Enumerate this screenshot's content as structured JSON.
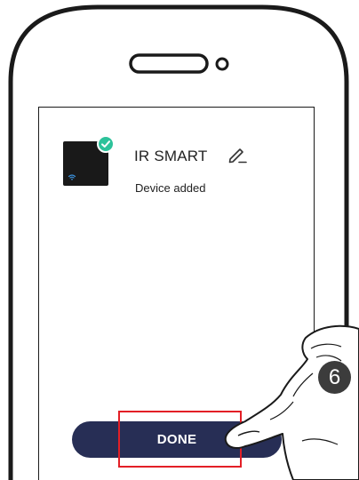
{
  "device": {
    "name": "IR SMART",
    "status": "Device added"
  },
  "icons": {
    "thumbnail": "device-thumbnail",
    "status_badge": "check-icon",
    "signal": "wifi-icon",
    "rename": "pencil-icon"
  },
  "actions": {
    "done_label": "DONE"
  },
  "instruction": {
    "step_number": "6"
  },
  "colors": {
    "button": "#272e55",
    "check_badge": "#2cc29a",
    "highlight": "#e31f26",
    "wifi": "#3a8fd8"
  }
}
